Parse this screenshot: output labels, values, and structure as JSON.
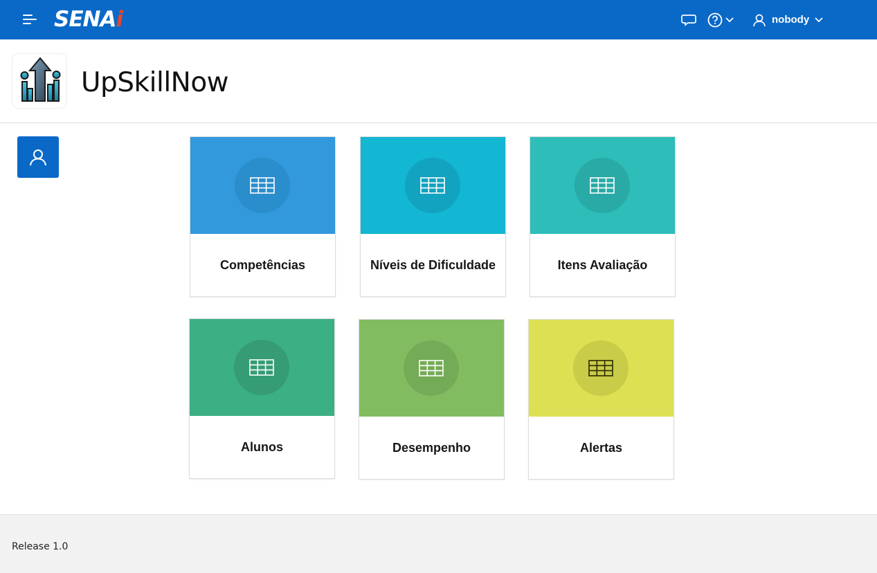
{
  "topbar": {
    "brand": "SENA",
    "brand_accent": "i",
    "user_name": "nobody",
    "icons": [
      "menu-icon",
      "chat-icon",
      "help-icon",
      "chevron-down-icon",
      "user-icon"
    ],
    "bg_color": "#0a69c7"
  },
  "header": {
    "app_title": "UpSkillNow"
  },
  "cards": [
    {
      "label": "Competências",
      "color": "#3399dd",
      "circle": "#2a8dcc",
      "icon": "table-icon"
    },
    {
      "label": "Níveis de Dificuldade",
      "color": "#13b6d3",
      "circle": "#11a3bf",
      "icon": "table-icon"
    },
    {
      "label": "Itens Avaliação",
      "color": "#2ebdb8",
      "circle": "#29aaa6",
      "icon": "table-icon"
    },
    {
      "label": "Alunos",
      "color": "#3cb083",
      "circle": "#359c74",
      "icon": "table-icon"
    },
    {
      "label": "Desempenho",
      "color": "#81bd60",
      "circle": "#74ab56",
      "icon": "table-icon"
    },
    {
      "label": "Alertas",
      "color": "#dde052",
      "circle": "#c9cc48",
      "icon": "table-icon"
    }
  ],
  "footer": {
    "release": "Release 1.0"
  }
}
